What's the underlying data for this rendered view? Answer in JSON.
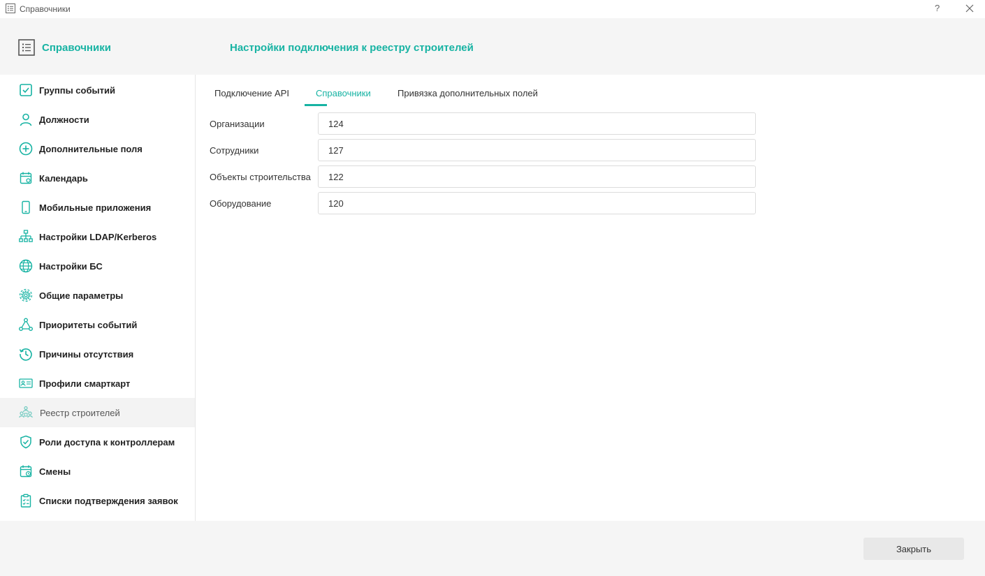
{
  "window": {
    "title": "Справочники",
    "help_label": "?"
  },
  "header": {
    "section_title": "Справочники",
    "page_title": "Настройки подключения к реестру строителей"
  },
  "theme": {
    "accent": "#17b3a3"
  },
  "sidebar": {
    "items": [
      {
        "label": "Группы событий",
        "icon": "checkbox-icon"
      },
      {
        "label": "Должности",
        "icon": "person-icon"
      },
      {
        "label": "Дополнительные поля",
        "icon": "plus-circle-icon"
      },
      {
        "label": "Календарь",
        "icon": "calendar-icon"
      },
      {
        "label": "Мобильные приложения",
        "icon": "mobile-icon"
      },
      {
        "label": "Настройки LDAP/Kerberos",
        "icon": "network-icon"
      },
      {
        "label": "Настройки БС",
        "icon": "globe-icon"
      },
      {
        "label": "Общие параметры",
        "icon": "gear-icon"
      },
      {
        "label": "Приоритеты событий",
        "icon": "nodes-icon"
      },
      {
        "label": "Причины отсутствия",
        "icon": "history-icon"
      },
      {
        "label": "Профили смарткарт",
        "icon": "id-card-icon"
      },
      {
        "label": "Реестр строителей",
        "icon": "builders-icon",
        "active": true
      },
      {
        "label": "Роли доступа к контроллерам",
        "icon": "shield-check-icon"
      },
      {
        "label": "Смены",
        "icon": "calendar-clock-icon"
      },
      {
        "label": "Списки подтверждения заявок",
        "icon": "clipboard-check-icon"
      }
    ]
  },
  "tabs": [
    {
      "label": "Подключение API",
      "active": false
    },
    {
      "label": "Справочники",
      "active": true
    },
    {
      "label": "Привязка дополнительных полей",
      "active": false
    }
  ],
  "form": {
    "fields": [
      {
        "label": "Организации",
        "value": "124"
      },
      {
        "label": "Сотрудники",
        "value": "127"
      },
      {
        "label": "Объекты строительства",
        "value": "122"
      },
      {
        "label": "Оборудование",
        "value": "120"
      }
    ]
  },
  "footer": {
    "close_label": "Закрыть"
  }
}
